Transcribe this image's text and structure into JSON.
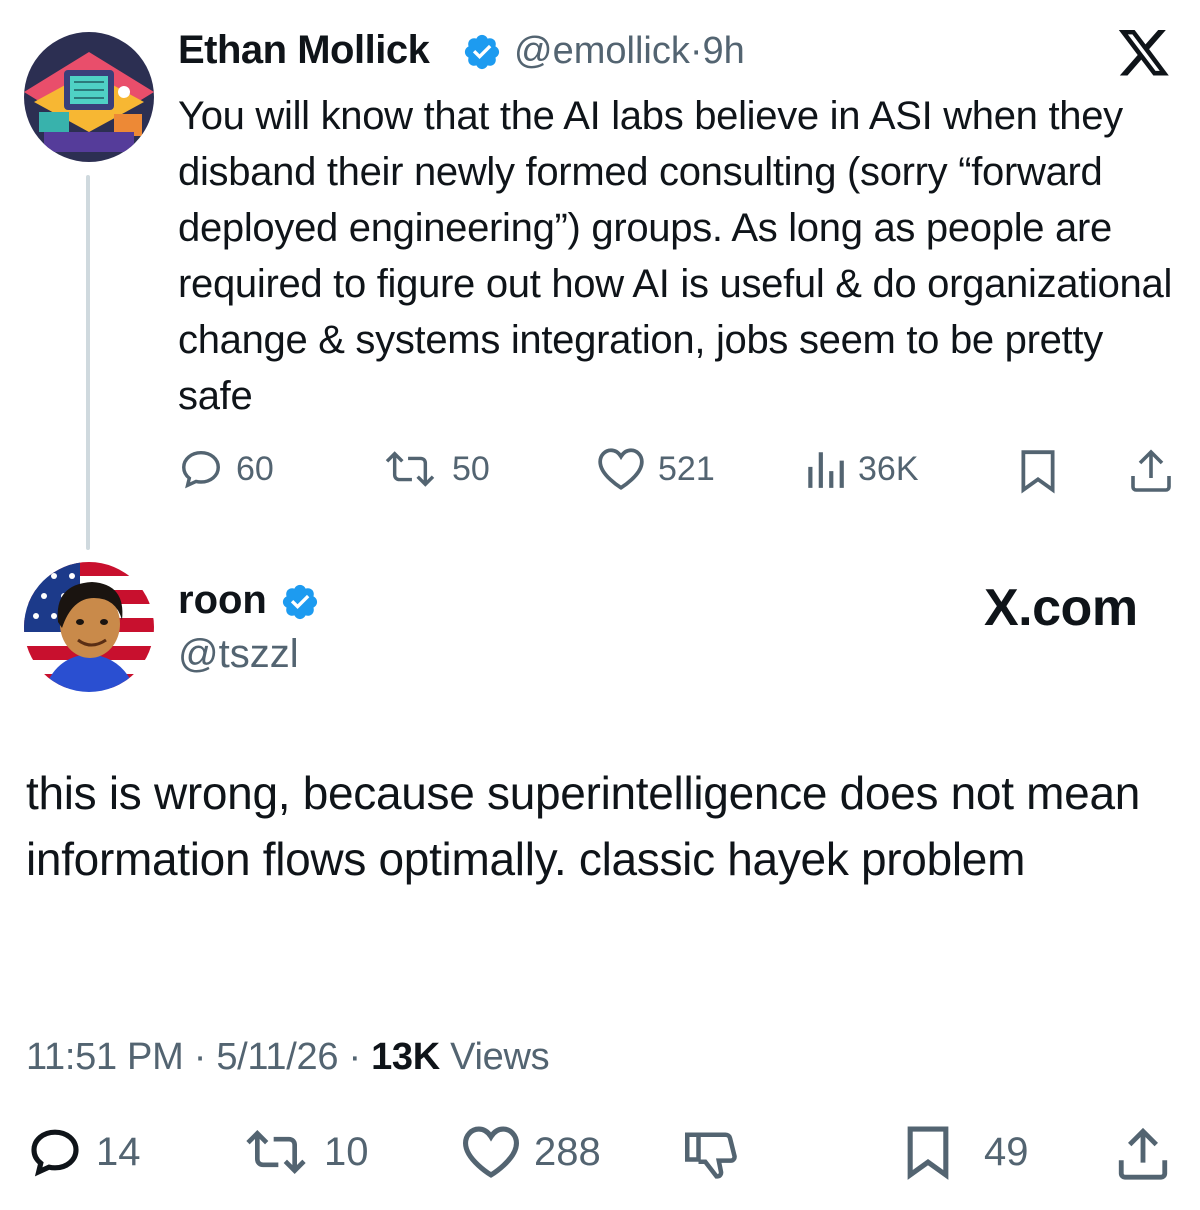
{
  "parent_tweet": {
    "author_name": "Ethan Mollick",
    "handle": "@emollick",
    "separator": "·",
    "time": "9h",
    "body": "You will know that the AI labs believe in ASI when they disband their newly formed consulting (sorry “forward deployed engineering”) groups. As long as people are required to figure out how AI is useful & do organizational change & systems integration, jobs seem to be pretty safe",
    "actions": {
      "replies": "60",
      "retweets": "50",
      "likes": "521",
      "views": "36K"
    },
    "icons": [
      "x-logo-icon",
      "verified-badge-icon",
      "reply-icon",
      "retweet-icon",
      "like-icon",
      "views-icon",
      "bookmark-icon",
      "share-icon"
    ]
  },
  "reply_tweet": {
    "author_name": "roon",
    "handle": "@tszzl",
    "brand": "X.com",
    "body": "this is wrong, because superintelligence does not mean information flows optimally. classic hayek problem",
    "meta": {
      "time": "11:51 PM",
      "sep1": "·",
      "date": "5/11/26",
      "sep2": "·",
      "views_count": "13K",
      "views_label": "Views"
    },
    "actions": {
      "replies": "14",
      "retweets": "10",
      "likes": "288",
      "bookmarks": "49"
    },
    "icons": [
      "reply-icon",
      "retweet-icon",
      "like-icon",
      "dislike-icon",
      "bookmark-icon",
      "share-icon"
    ]
  },
  "colors": {
    "text": "#0f1419",
    "secondary": "#536471",
    "verified": "#1d9bf0",
    "thread_line": "#cfd9de"
  }
}
